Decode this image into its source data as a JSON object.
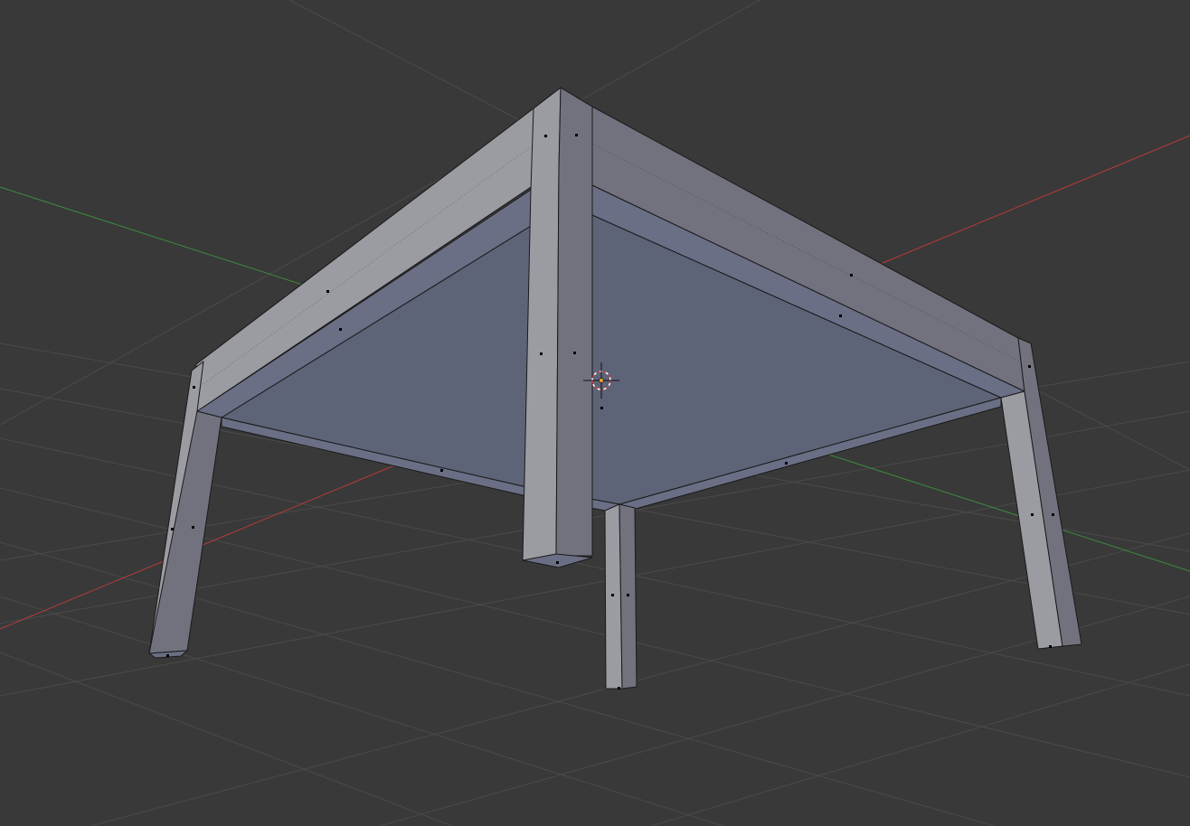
{
  "viewport": {
    "name": "3D Viewport",
    "colors": {
      "background": "#393939",
      "grid_line": "#4a4a4a",
      "x_axis": "#b83a3a",
      "y_axis": "#3c8c3c",
      "mesh_face_light": "#9b9ba2",
      "mesh_face_dark": "#72727f",
      "mesh_underside": "#5e6478",
      "edge": "#1a1a1a",
      "vertex": "#000000",
      "cursor_ring": "#d23a3a",
      "object_origin": "#f0a030"
    },
    "object": {
      "name": "table",
      "parts": [
        "tabletop",
        "leg-left",
        "leg-front-center",
        "leg-back-center",
        "leg-right"
      ]
    },
    "icons": {
      "cursor": "3d-cursor-icon",
      "origin": "object-origin-icon"
    }
  }
}
